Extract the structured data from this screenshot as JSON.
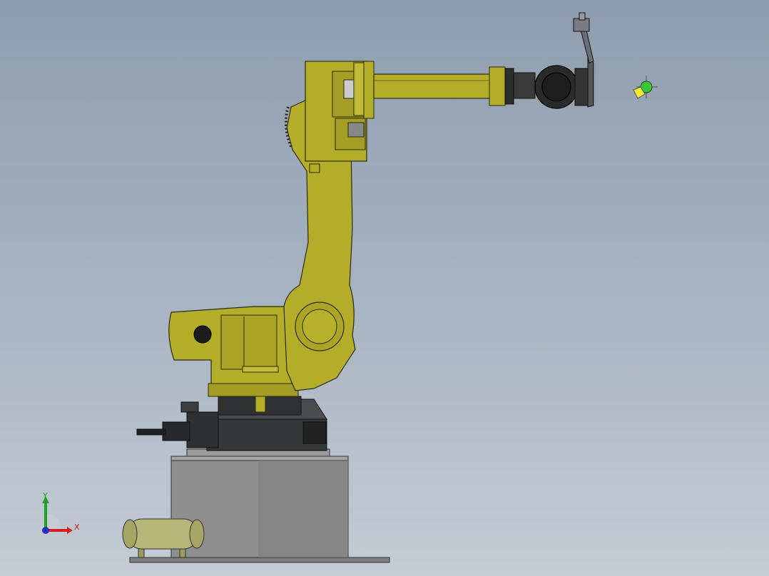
{
  "viewport": {
    "description_free": true,
    "colors": {
      "background_top": "#8e9dae",
      "background_bottom": "#c4ccd5",
      "robot_body": "#b3ad2a",
      "robot_body_dark": "#8c8720",
      "robot_edge": "#2b2a12",
      "motor_dark": "#2a2c2e",
      "pedestal": "#8f8f8f",
      "pedestal_dark": "#6f6f6f",
      "tank": "#b6b679",
      "gizmo_green": "#36c83a",
      "gizmo_yellow": "#f2ee36"
    }
  },
  "triad": {
    "x_label": "X",
    "y_label": "Y",
    "x_color": "#d02020",
    "y_color": "#20a020",
    "z_color": "#2030c0",
    "icon": "coordinate-triad-icon"
  },
  "tcp_marker": {
    "icon": "tool-center-point-icon"
  }
}
